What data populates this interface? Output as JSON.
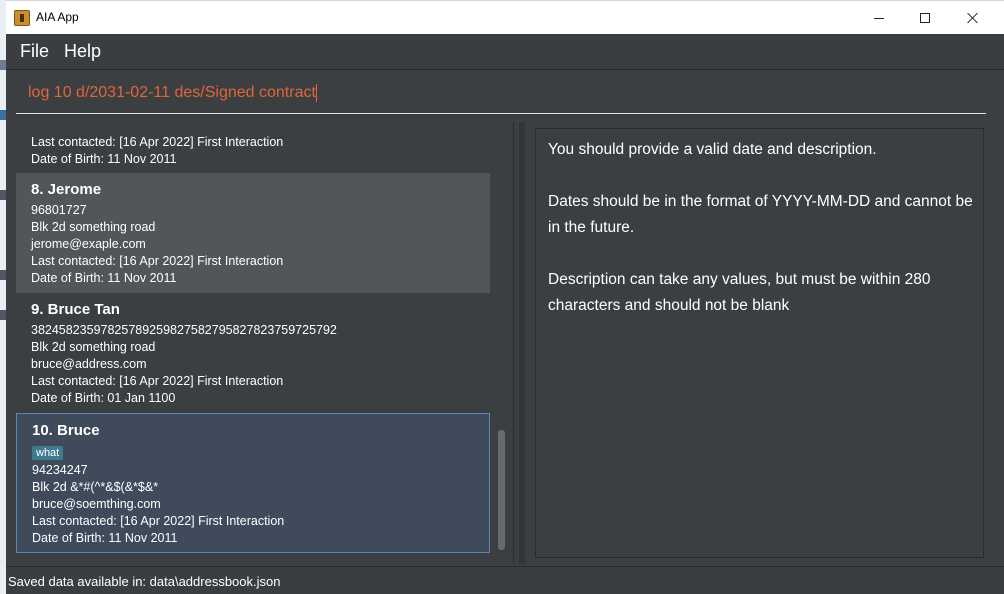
{
  "window": {
    "title": "AIA App"
  },
  "menu": {
    "file": "File",
    "help": "Help"
  },
  "command": {
    "value": "log 10 d/2031-02-11 des/Signed contract"
  },
  "contacts": {
    "partial": {
      "last_contacted": "Last contacted: [16 Apr 2022] First Interaction",
      "dob": "Date of Birth: 11 Nov 2011"
    },
    "items": [
      {
        "name": "8.  Jerome",
        "phone": "96801727",
        "address": "Blk 2d something road",
        "email": "jerome@exaple.com",
        "last_contacted": "Last contacted: [16 Apr 2022] First Interaction",
        "dob": "Date of Birth: 11 Nov 2011"
      },
      {
        "name": "9.  Bruce Tan",
        "phone": "38245823597825789259827582795827823759725792",
        "address": "Blk 2d something road",
        "email": "bruce@address.com",
        "last_contacted": "Last contacted: [16 Apr 2022] First Interaction",
        "dob": "Date of Birth: 01 Jan 1100"
      },
      {
        "name": "10.  Bruce",
        "tag": "what",
        "phone": "94234247",
        "address": "Blk 2d &*#(^*&$(&*$&*",
        "email": "bruce@soemthing.com",
        "last_contacted": "Last contacted: [16 Apr 2022] First Interaction",
        "dob": "Date of Birth: 11 Nov 2011"
      }
    ]
  },
  "result": {
    "p1": "You should provide a valid date and description.",
    "p2": "Dates should be in the format of YYYY-MM-DD and cannot be in the future.",
    "p3": "Description can take any values, but must be within 280 characters and should not be blank"
  },
  "status": {
    "text": "Saved data available in: data\\addressbook.json"
  },
  "colors": {
    "background": "#3c3f41",
    "selected_card": "#3f4a5a",
    "selected_border": "#5a86b5",
    "hover_card": "#515658",
    "command_text": "#e0653a",
    "tag": "#3e7b91"
  }
}
